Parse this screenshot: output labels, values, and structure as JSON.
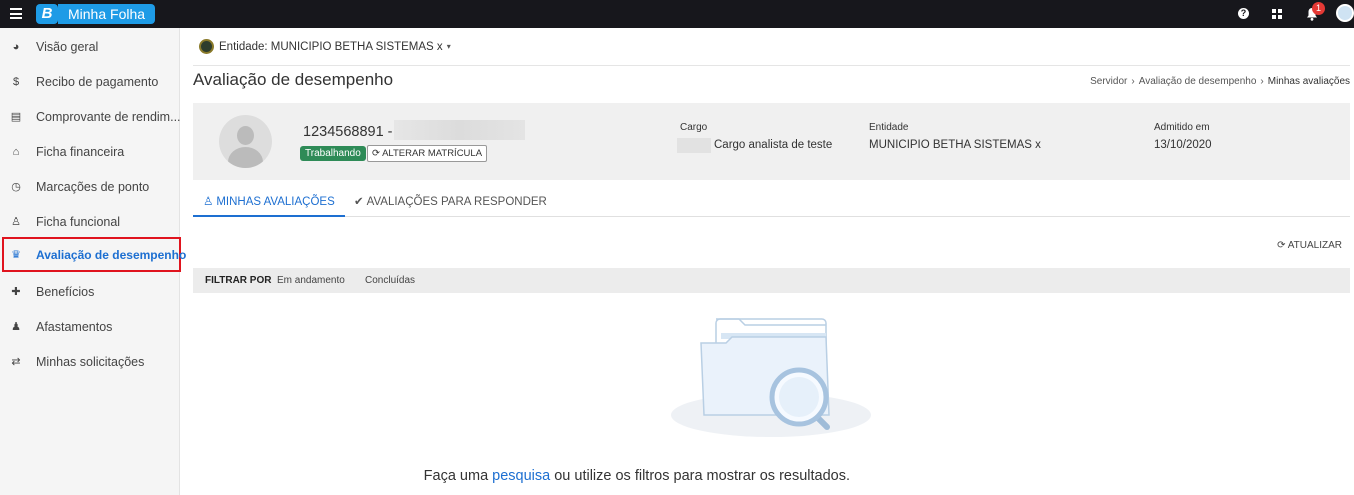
{
  "header": {
    "logo_letter": "B",
    "app_name": "Minha Folha",
    "help_symbol": "?",
    "notification_count": "1"
  },
  "sidebar": {
    "items": [
      {
        "label": "Visão geral",
        "icon": "pie-chart-icon",
        "glyph": "◕"
      },
      {
        "label": "Recibo de pagamento",
        "icon": "dollar-icon",
        "glyph": "$"
      },
      {
        "label": "Comprovante de rendim...",
        "icon": "document-icon",
        "glyph": "▤"
      },
      {
        "label": "Ficha financeira",
        "icon": "bank-icon",
        "glyph": "⌂"
      },
      {
        "label": "Marcações de ponto",
        "icon": "clock-icon",
        "glyph": "◷"
      },
      {
        "label": "Ficha funcional",
        "icon": "user-icon",
        "glyph": "♙"
      },
      {
        "label": "Avaliação de desempenho",
        "icon": "trophy-icon",
        "glyph": "♛"
      },
      {
        "label": "Benefícios",
        "icon": "gift-icon",
        "glyph": "✚"
      },
      {
        "label": "Afastamentos",
        "icon": "user-x-icon",
        "glyph": "♟"
      },
      {
        "label": "Minhas solicitações",
        "icon": "exchange-icon",
        "glyph": "⇄"
      }
    ],
    "active_index": 6
  },
  "entity": {
    "label": "Entidade: MUNICIPIO BETHA SISTEMAS x"
  },
  "page": {
    "title": "Avaliação de desempenho",
    "breadcrumb": [
      "Servidor",
      "Avaliação de desempenho",
      "Minhas avaliações"
    ]
  },
  "profile": {
    "matricula": "1234568891 -",
    "status": "Trabalhando",
    "alter_button": "ALTERAR MATRÍCULA",
    "cargo_label": "Cargo",
    "cargo_value": "Cargo analista de teste",
    "entidade_label": "Entidade",
    "entidade_value": "MUNICIPIO BETHA SISTEMAS x",
    "admitido_label": "Admitido em",
    "admitido_value": "13/10/2020"
  },
  "tabs": [
    {
      "label": "MINHAS AVALIAÇÕES",
      "icon": "user-icon"
    },
    {
      "label": "AVALIAÇÕES PARA RESPONDER",
      "icon": "check-icon"
    }
  ],
  "actions": {
    "refresh": "ATUALIZAR"
  },
  "filters": {
    "label": "FILTRAR POR",
    "options": [
      "Em andamento",
      "Concluídas"
    ]
  },
  "empty_state": {
    "prefix": "Faça uma ",
    "link": "pesquisa",
    "suffix": " ou utilize os filtros para mostrar os resultados."
  },
  "colors": {
    "accent": "#1d6fd1",
    "topbar": "#17171c",
    "brand": "#1e9be6",
    "status_ok": "#2e8b57",
    "highlight_border": "#e0141e"
  }
}
